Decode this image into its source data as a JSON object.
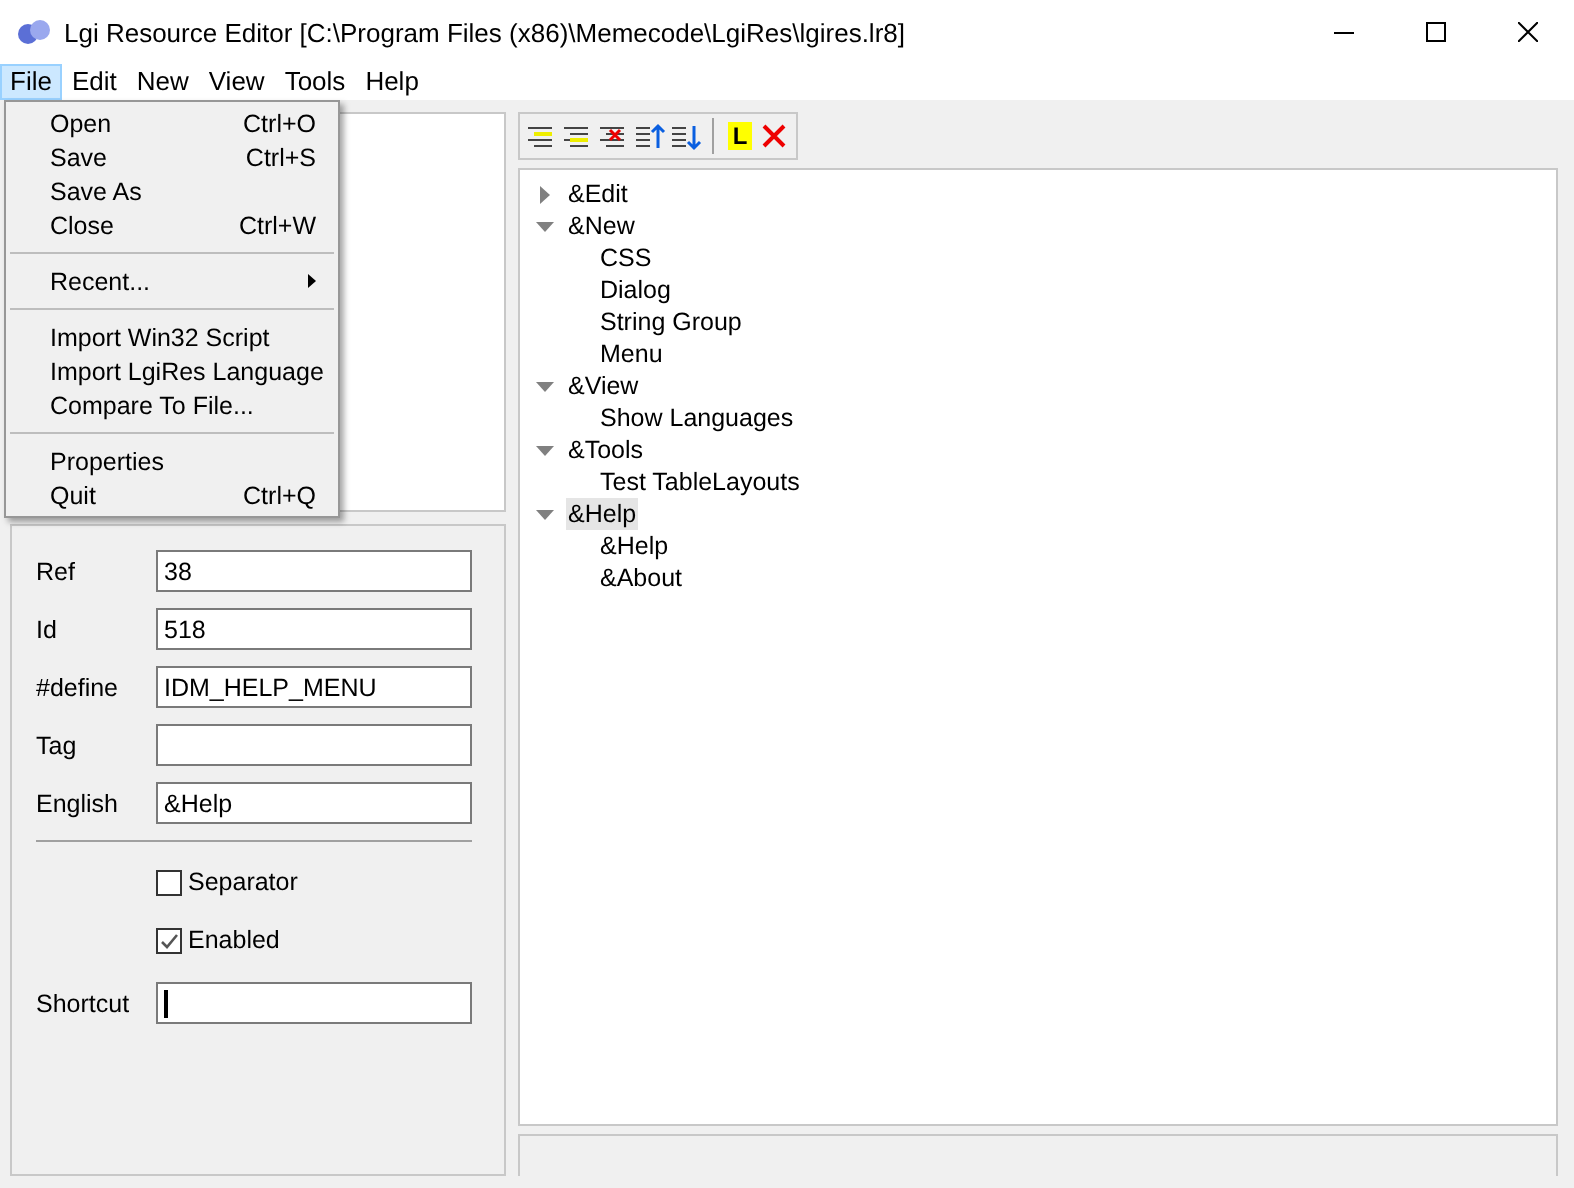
{
  "window": {
    "title": "Lgi Resource Editor [C:\\Program Files (x86)\\Memecode\\LgiRes\\lgires.lr8]"
  },
  "menubar": [
    {
      "label": "File",
      "selected": true
    },
    {
      "label": "Edit",
      "selected": false
    },
    {
      "label": "New",
      "selected": false
    },
    {
      "label": "View",
      "selected": false
    },
    {
      "label": "Tools",
      "selected": false
    },
    {
      "label": "Help",
      "selected": false
    }
  ],
  "file_menu": [
    {
      "kind": "item",
      "label": "Open",
      "shortcut": "Ctrl+O"
    },
    {
      "kind": "item",
      "label": "Save",
      "shortcut": "Ctrl+S"
    },
    {
      "kind": "item",
      "label": "Save As"
    },
    {
      "kind": "item",
      "label": "Close",
      "shortcut": "Ctrl+W"
    },
    {
      "kind": "separator"
    },
    {
      "kind": "submenu",
      "label": "Recent..."
    },
    {
      "kind": "separator"
    },
    {
      "kind": "item",
      "label": "Import Win32 Script"
    },
    {
      "kind": "item",
      "label": "Import LgiRes Language"
    },
    {
      "kind": "item",
      "label": "Compare To File..."
    },
    {
      "kind": "separator"
    },
    {
      "kind": "item",
      "label": "Properties"
    },
    {
      "kind": "item",
      "label": "Quit",
      "shortcut": "Ctrl+Q"
    }
  ],
  "toolbar": {
    "label_button": "L"
  },
  "tree": [
    {
      "label": "&Edit",
      "expanded": false,
      "selected": false
    },
    {
      "label": "&New",
      "expanded": true,
      "selected": false,
      "children": [
        {
          "label": "CSS",
          "selected": false
        },
        {
          "label": "Dialog",
          "selected": false
        },
        {
          "label": "String Group",
          "selected": false
        },
        {
          "label": "Menu",
          "selected": false
        }
      ]
    },
    {
      "label": "&View",
      "expanded": true,
      "selected": false,
      "children": [
        {
          "label": "Show Languages",
          "selected": false
        }
      ]
    },
    {
      "label": "&Tools",
      "expanded": true,
      "selected": false,
      "children": [
        {
          "label": "Test TableLayouts",
          "selected": false
        }
      ]
    },
    {
      "label": "&Help",
      "expanded": true,
      "selected": true,
      "children": [
        {
          "label": "&Help",
          "selected": false
        },
        {
          "label": "&About",
          "selected": false
        }
      ]
    }
  ],
  "properties": {
    "fields": [
      {
        "label": "Ref",
        "value": "38"
      },
      {
        "label": "Id",
        "value": "518"
      },
      {
        "label": "#define",
        "value": "IDM_HELP_MENU"
      },
      {
        "label": "Tag"
      },
      {
        "label": "English",
        "value": "&Help"
      }
    ],
    "checkboxes": [
      {
        "label": "Separator",
        "checked": false
      },
      {
        "label": "Enabled",
        "checked": true
      }
    ],
    "shortcut": {
      "label": "Shortcut",
      "focused": true
    }
  }
}
